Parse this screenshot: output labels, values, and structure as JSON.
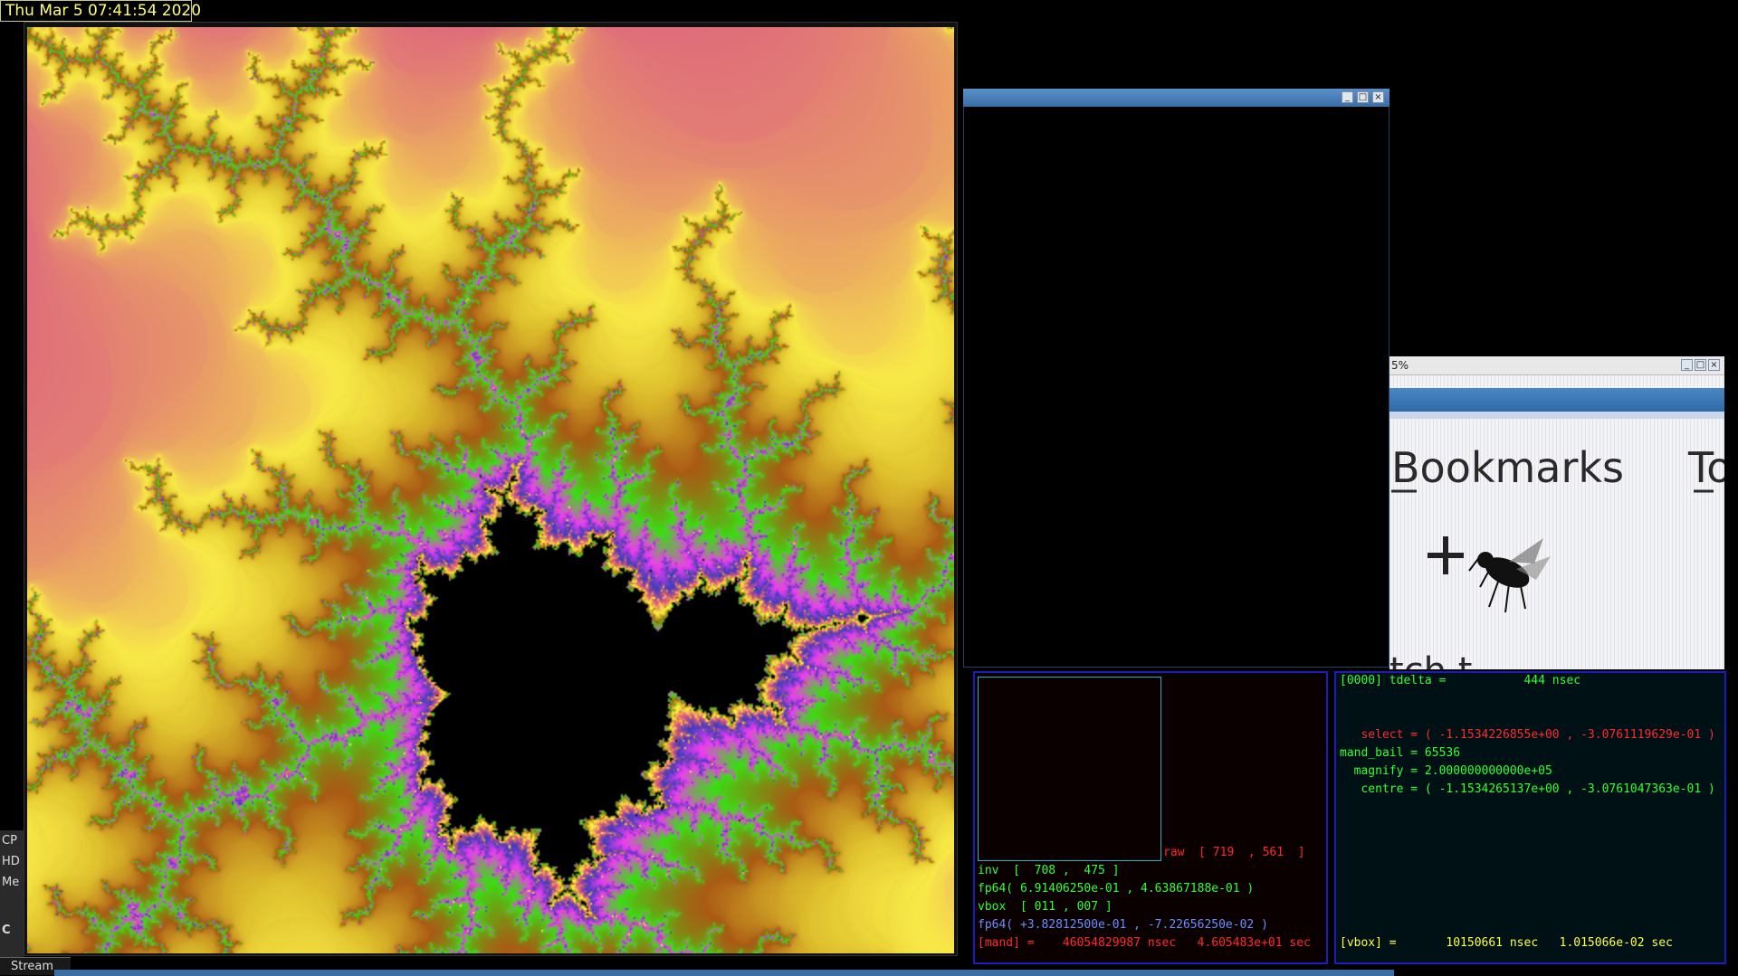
{
  "clock": {
    "text": "Thu Mar  5 07:41:54 2020"
  },
  "side_tray": {
    "items": [
      "CP",
      "HD",
      "Me"
    ],
    "bottom_label": "C"
  },
  "stream_tab": {
    "label": "Stream"
  },
  "photo_window": {
    "title": "5%",
    "overlay_text_1": "Bookmarks",
    "overlay_text_2": "To",
    "overlay_text_3": "tch t"
  },
  "left_panel": {
    "raw": "raw  [ 719  , 561  ]",
    "inv": "inv  [  708 ,  475 ]",
    "fp64_a": "fp64( 6.91406250e-01 , 4.63867188e-01 )",
    "vbox": "vbox  [ 011 , 007 ]",
    "fp64_b": "fp64( +3.82812500e-01 , -7.22656250e-02 )",
    "mand": "[mand] =    46054829987 nsec   4.605483e+01 sec"
  },
  "right_panel": {
    "tdelta": "[0000] tdelta =           444 nsec",
    "select": "   select = ( -1.1534226855e+00 , -3.0761119629e-01 )",
    "mand_bail": "mand_bail = 65536",
    "magnify": "  magnify = 2.000000000000e+05",
    "centre": "   centre = ( -1.1534265137e+00 , -3.0761047363e-01 )",
    "vbox": "[vbox] =       10150661 nsec   1.015066e-02 sec"
  },
  "window_buttons": {
    "minimize": "_",
    "maximize": "□",
    "close": "×"
  },
  "colors": {
    "titlebar": "#3a6ea5",
    "panel_border": "#1b1bc0",
    "inner_box": "#1fb4c8"
  }
}
